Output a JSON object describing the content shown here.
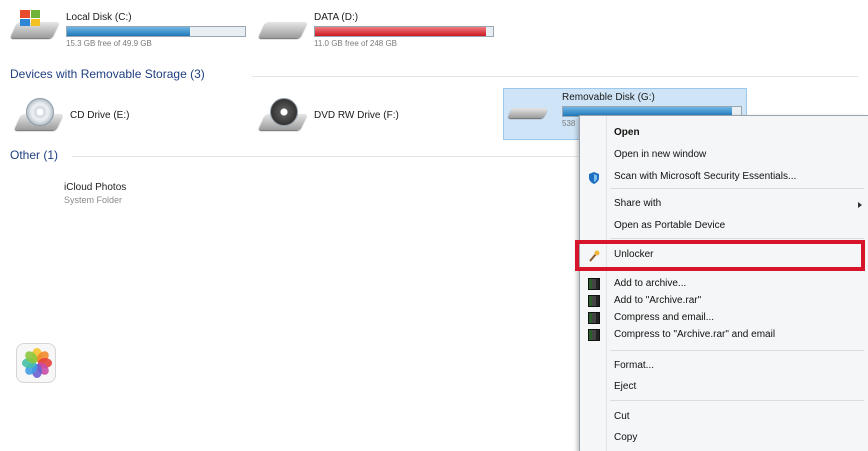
{
  "drives": [
    {
      "name": "Local Disk (C:)",
      "free": "15.3 GB free of 49.9 GB",
      "used_fraction": 0.69,
      "bar_color": "#2c86c4"
    },
    {
      "name": "DATA (D:)",
      "free": "11.0 GB free of 248 GB",
      "used_fraction": 0.96,
      "bar_color": "#d9232d"
    }
  ],
  "sections": {
    "removable": "Devices with Removable Storage (3)",
    "other": "Other (1)"
  },
  "removable": [
    {
      "name": "CD Drive (E:)"
    },
    {
      "name": "DVD RW Drive (F:)"
    },
    {
      "name": "Removable Disk (G:)",
      "free": "538",
      "used_fraction": 0.95,
      "bar_color": "#2c86c4"
    }
  ],
  "other": [
    {
      "name": "iCloud Photos",
      "type": "System Folder"
    }
  ],
  "context_menu": {
    "items": [
      {
        "label": "Open",
        "bold": true
      },
      {
        "label": "Open in new window"
      },
      {
        "label": "Scan with Microsoft Security Essentials...",
        "icon": "shield-icon"
      },
      {
        "label": "Share with",
        "submenu": true
      },
      {
        "label": "Open as Portable Device"
      },
      {
        "label": "Unlocker",
        "icon": "wand-icon",
        "highlighted": true
      },
      {
        "label": "Add to archive...",
        "icon": "winrar-icon"
      },
      {
        "label": "Add to \"Archive.rar\"",
        "icon": "winrar-icon"
      },
      {
        "label": "Compress and email...",
        "icon": "winrar-icon"
      },
      {
        "label": "Compress to \"Archive.rar\" and email",
        "icon": "winrar-icon"
      },
      {
        "label": "Format..."
      },
      {
        "label": "Eject"
      },
      {
        "label": "Cut"
      },
      {
        "label": "Copy"
      }
    ]
  },
  "colors": {
    "section_text": "#1f3f7f",
    "highlight_border": "#d6142a",
    "selection_fill": "#cfe5f7"
  }
}
